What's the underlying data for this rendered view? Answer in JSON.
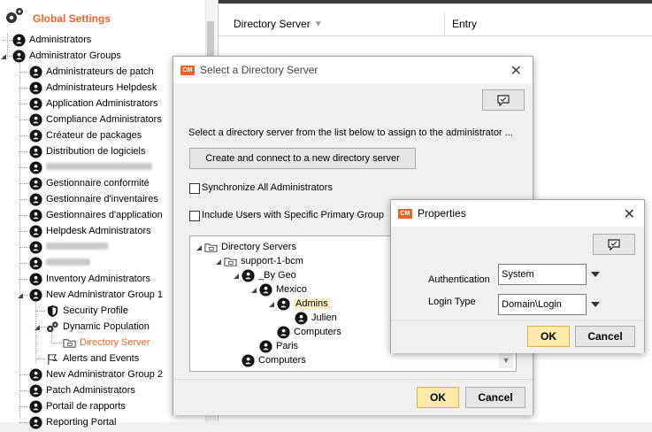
{
  "sidebar": {
    "title": "Global Settings",
    "items": [
      {
        "label": "Administrators",
        "blurred": false
      },
      {
        "label": "Administrator Groups",
        "blurred": false
      },
      {
        "label": "Administrateurs de patch",
        "blurred": false
      },
      {
        "label": "Administrateurs Helpdesk",
        "blurred": false
      },
      {
        "label": "Application Administrators",
        "blurred": false
      },
      {
        "label": "Compliance Administrators",
        "blurred": false
      },
      {
        "label": "Créateur de packages",
        "blurred": false
      },
      {
        "label": "Distribution de logiciels",
        "blurred": false
      },
      {
        "label": "",
        "blurred": true
      },
      {
        "label": "Gestionnaire conformité",
        "blurred": false
      },
      {
        "label": "Gestionnaire d'inventaires",
        "blurred": false
      },
      {
        "label": "Gestionnaires d'application",
        "blurred": false
      },
      {
        "label": "Helpdesk Administrators",
        "blurred": false
      },
      {
        "label": "",
        "blurred": true
      },
      {
        "label": "",
        "blurred": true
      },
      {
        "label": "Inventory Administrators",
        "blurred": false
      },
      {
        "label": "New Administrator Group 1",
        "blurred": false
      },
      {
        "label": "Security Profile",
        "blurred": false
      },
      {
        "label": "Dynamic Population",
        "blurred": false
      },
      {
        "label": "Directory Server",
        "blurred": false
      },
      {
        "label": "Alerts and Events",
        "blurred": false
      },
      {
        "label": "New Administrator Group 2",
        "blurred": false
      },
      {
        "label": "Patch Administrators",
        "blurred": false
      },
      {
        "label": "Portail de rapports",
        "blurred": false
      },
      {
        "label": "Reporting Portal",
        "blurred": false
      }
    ]
  },
  "main": {
    "columns": [
      "Directory Server",
      "Entry"
    ]
  },
  "dialog_select": {
    "title": "Select a Directory Server",
    "instruction": "Select a directory server from the list below to assign to the administrator ...",
    "create_button": "Create and connect to a new directory server",
    "sync_label": "Synchronize All Administrators",
    "include_label": "Include Users with Specific Primary Group",
    "tree": [
      "Directory Servers",
      "support-1-bcm",
      "_By Geo",
      "Mexico",
      "Admins",
      "Julien",
      "Computers",
      "Paris",
      "Computers"
    ],
    "ok_label": "OK",
    "cancel_label": "Cancel",
    "logo_text": "CM"
  },
  "dialog_props": {
    "title": "Properties",
    "auth_label": "Authentication",
    "auth_value": "System",
    "login_label": "Login Type",
    "login_value": "Domain\\Login",
    "ok_label": "OK",
    "cancel_label": "Cancel",
    "logo_text": "CM"
  },
  "colors": {
    "accent": "#e8652a",
    "primary_button": "#fde9a9",
    "selection": "#fdf0c8"
  }
}
